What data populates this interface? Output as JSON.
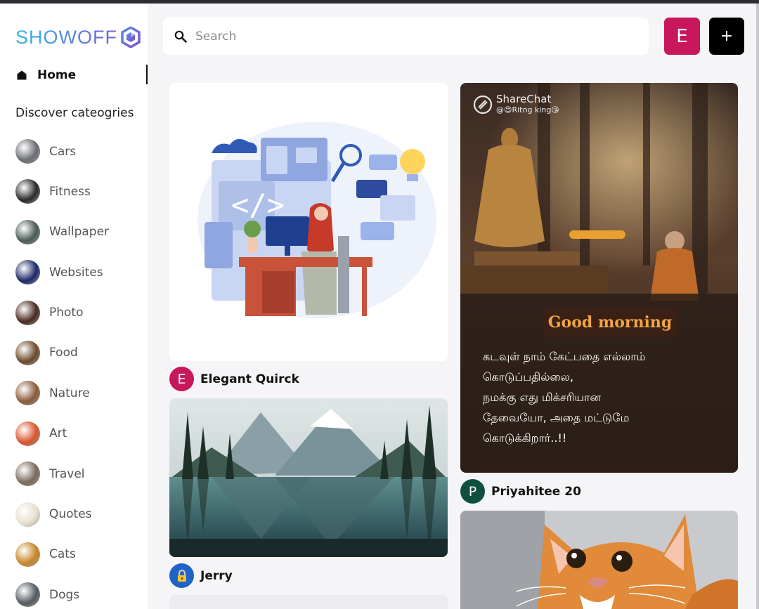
{
  "app": {
    "logo_text": "SHOWOFF",
    "logo_color": "#4f8fe2"
  },
  "sidebar": {
    "home_label": "Home",
    "discover_heading": "Discover cateogries",
    "categories": [
      {
        "label": "Cars",
        "color": "#6b6e73"
      },
      {
        "label": "Fitness",
        "color": "#2a2a2a"
      },
      {
        "label": "Wallpaper",
        "color": "#4a5a55"
      },
      {
        "label": "Websites",
        "color": "#1c2a6a"
      },
      {
        "label": "Photo",
        "color": "#4a2a1e"
      },
      {
        "label": "Food",
        "color": "#6b4a2a"
      },
      {
        "label": "Nature",
        "color": "#8a5a3a"
      },
      {
        "label": "Art",
        "color": "#d8552b"
      },
      {
        "label": "Travel",
        "color": "#7a6a5a"
      },
      {
        "label": "Quotes",
        "color": "#e8e0d0"
      },
      {
        "label": "Cats",
        "color": "#c8862a"
      },
      {
        "label": "Dogs",
        "color": "#555a60"
      }
    ]
  },
  "header": {
    "search_placeholder": "Search",
    "user_initial": "E",
    "user_color": "#c8175d",
    "create_label": "+"
  },
  "pins": {
    "pin1": {
      "author": "Elegant Quirck",
      "initial": "E",
      "avatar_color": "#c8175d",
      "icon": "coding-illustration"
    },
    "pin2": {
      "author": "Jerry",
      "avatar_color": "#1e63c6",
      "icon": "lock-icon"
    },
    "pin3": {
      "author": "Priyahitee 20",
      "initial": "P",
      "avatar_color": "#0f5040",
      "watermark": "ShareChat",
      "handle": "@😍Ritng king😘",
      "greeting": "Good morning",
      "quote_lines": [
        "கடவுள் நாம் கேட்பதை எல்லாம்",
        "கொடுப்பதில்லை,",
        "நமக்கு எது மிக்சரியான",
        "தேவையோ, அதை மட்டுமே",
        "கொடுக்கிறார்..!!"
      ]
    },
    "pin4": {
      "icon": "cat-photo"
    }
  }
}
